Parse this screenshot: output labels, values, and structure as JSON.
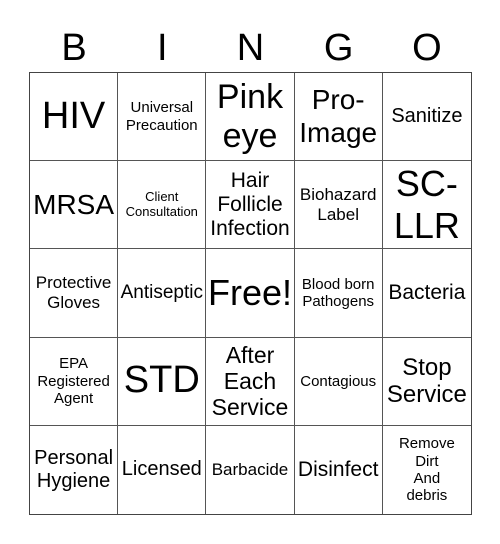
{
  "header": [
    "B",
    "I",
    "N",
    "G",
    "O"
  ],
  "cells": [
    "HIV",
    "Universal\nPrecaution",
    "Pink\neye",
    "Pro-\nImage",
    "Sanitize",
    "MRSA",
    "Client\nConsultation",
    "Hair\nFollicle\nInfection",
    "Biohazard\nLabel",
    "SC-\nLLR",
    "Protective\nGloves",
    "Antiseptic",
    "Free!",
    "Blood born\nPathogens",
    "Bacteria",
    "EPA\nRegistered\nAgent",
    "STD",
    "After\nEach\nService",
    "Contagious",
    "Stop\nService",
    "Personal\nHygiene",
    "Licensed",
    "Barbacide",
    "Disinfect",
    "Remove\nDirt\nAnd\ndebris"
  ]
}
